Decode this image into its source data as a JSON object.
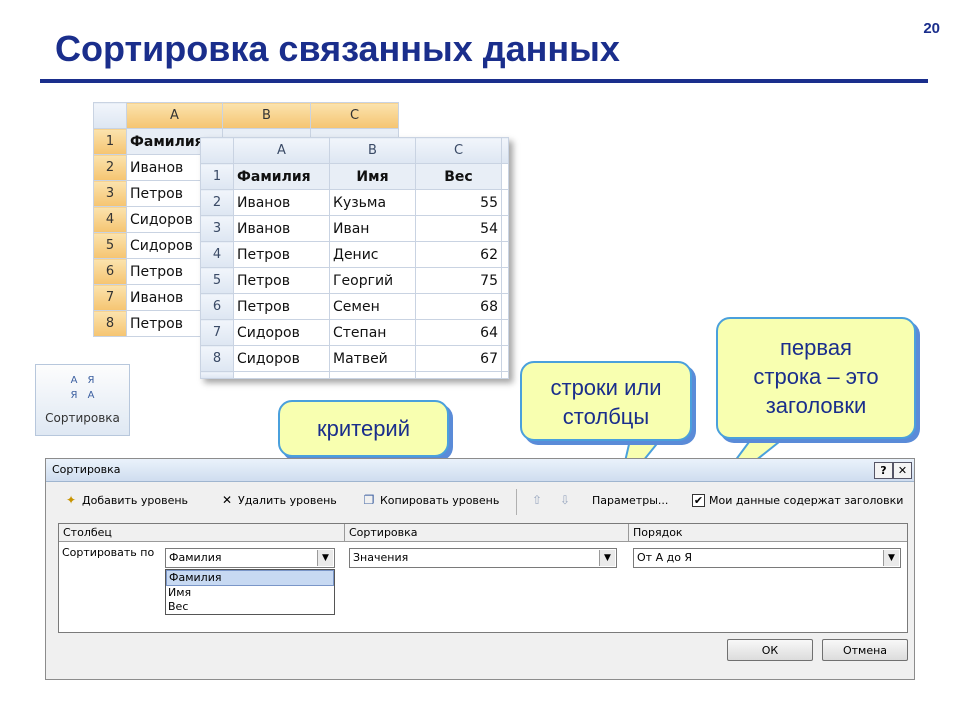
{
  "slide": {
    "number": "20",
    "title": "Сортировка связанных данных"
  },
  "sheet_back": {
    "columns": [
      "A",
      "B",
      "C"
    ],
    "rows": [
      {
        "num": "1",
        "a": "Фамилия"
      },
      {
        "num": "2",
        "a": "Иванов"
      },
      {
        "num": "3",
        "a": "Петров"
      },
      {
        "num": "4",
        "a": "Сидоров"
      },
      {
        "num": "5",
        "a": "Сидоров"
      },
      {
        "num": "6",
        "a": "Петров"
      },
      {
        "num": "7",
        "a": "Иванов"
      },
      {
        "num": "8",
        "a": "Петров"
      }
    ]
  },
  "sheet_front": {
    "columns": [
      "A",
      "B",
      "C"
    ],
    "rows": [
      {
        "num": "1",
        "a": "Фамилия",
        "b": "Имя",
        "c": "Вес"
      },
      {
        "num": "2",
        "a": "Иванов",
        "b": "Кузьма",
        "c": "55"
      },
      {
        "num": "3",
        "a": "Иванов",
        "b": "Иван",
        "c": "54"
      },
      {
        "num": "4",
        "a": "Петров",
        "b": "Денис",
        "c": "62"
      },
      {
        "num": "5",
        "a": "Петров",
        "b": "Георгий",
        "c": "75"
      },
      {
        "num": "6",
        "a": "Петров",
        "b": "Семен",
        "c": "68"
      },
      {
        "num": "7",
        "a": "Сидоров",
        "b": "Степан",
        "c": "64"
      },
      {
        "num": "8",
        "a": "Сидоров",
        "b": "Матвей",
        "c": "67"
      }
    ]
  },
  "ribbon": {
    "sort_label": "Сортировка",
    "icon_letters": [
      "А",
      "Я",
      "Я",
      "А"
    ]
  },
  "callouts": {
    "criterion": "критерий",
    "rows_cols_line1": "строки или",
    "rows_cols_line2": "столбцы",
    "header_line1": "первая",
    "header_line2": "строка – это",
    "header_line3": "заголовки"
  },
  "dialog": {
    "title": "Сортировка",
    "help": "?",
    "close": "✕",
    "toolbar": {
      "add_level": "Добавить уровень",
      "delete_level": "Удалить уровень",
      "copy_level": "Копировать уровень",
      "up": "⇧",
      "down": "⇩",
      "options": "Параметры...",
      "has_headers_checked": "✔",
      "has_headers": "Мои данные содержат заголовки"
    },
    "headers": {
      "column": "Столбец",
      "sort_on": "Сортировка",
      "order": "Порядок"
    },
    "row": {
      "label": "Сортировать по",
      "column_value": "Фамилия",
      "sort_on_value": "Значения",
      "order_value": "От А до Я"
    },
    "dropdown_options": [
      "Фамилия",
      "Имя",
      "Вес"
    ],
    "ok": "ОК",
    "cancel": "Отмена"
  },
  "colors": {
    "title": "#1a2e8c",
    "callout_fill": "#f8ffb0",
    "callout_border": "#4aa0dc",
    "callout_shadow": "#5a8bd8"
  }
}
